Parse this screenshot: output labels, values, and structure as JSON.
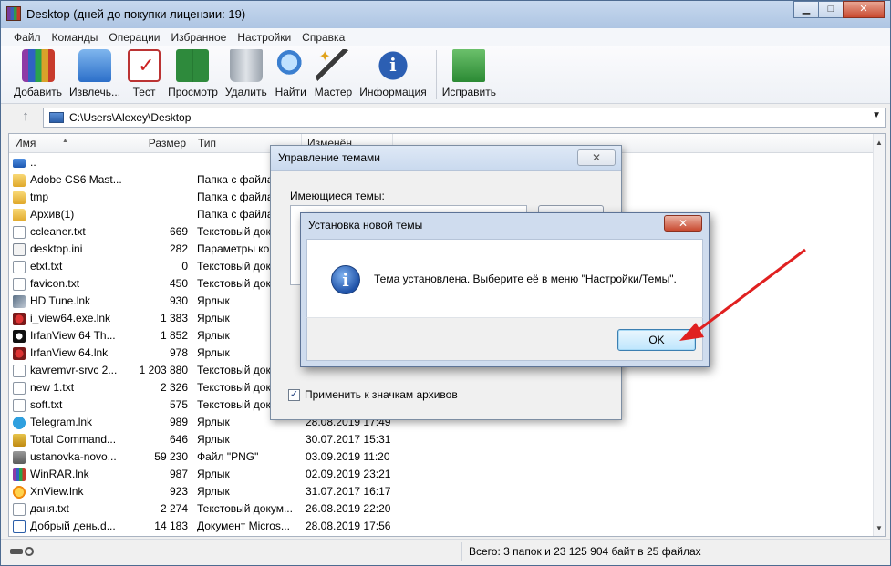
{
  "window": {
    "title": "Desktop (дней до покупки лицензии: 19)",
    "buttons": {
      "minimize": "▁",
      "maximize": "□",
      "close": "✕"
    }
  },
  "menu": [
    "Файл",
    "Команды",
    "Операции",
    "Избранное",
    "Настройки",
    "Справка"
  ],
  "toolbar": [
    {
      "label": "Добавить",
      "icon": "archive-add-icon"
    },
    {
      "label": "Извлечь...",
      "icon": "extract-folder-icon"
    },
    {
      "label": "Тест",
      "icon": "test-checklist-icon"
    },
    {
      "label": "Просмотр",
      "icon": "book-view-icon"
    },
    {
      "label": "Удалить",
      "icon": "trash-icon"
    },
    {
      "label": "Найти",
      "icon": "magnifier-icon"
    },
    {
      "label": "Мастер",
      "icon": "magic-wand-icon"
    },
    {
      "label": "Информация",
      "icon": "info-icon"
    },
    {
      "label": "Исправить",
      "icon": "repair-kit-icon"
    }
  ],
  "address": {
    "up_glyph": "↑",
    "path": "C:\\Users\\Alexey\\Desktop",
    "dropdown_glyph": "▼"
  },
  "columns": {
    "name": "Имя",
    "size": "Размер",
    "type": "Тип",
    "modified": "Изменён"
  },
  "files": [
    {
      "name": "..",
      "size": "",
      "type": "",
      "date": "",
      "icon": "up"
    },
    {
      "name": "Adobe CS6 Mast...",
      "size": "",
      "type": "Папка с файла",
      "date": "",
      "icon": "folder"
    },
    {
      "name": "tmp",
      "size": "",
      "type": "Папка с файла",
      "date": "",
      "icon": "folder"
    },
    {
      "name": "Архив(1)",
      "size": "",
      "type": "Папка с файла",
      "date": "",
      "icon": "folder"
    },
    {
      "name": "ccleaner.txt",
      "size": "669",
      "type": "Текстовый док",
      "date": "",
      "icon": "txt"
    },
    {
      "name": "desktop.ini",
      "size": "282",
      "type": "Параметры ко",
      "date": "",
      "icon": "ini"
    },
    {
      "name": "etxt.txt",
      "size": "0",
      "type": "Текстовый док",
      "date": "",
      "icon": "txt"
    },
    {
      "name": "favicon.txt",
      "size": "450",
      "type": "Текстовый док",
      "date": "",
      "icon": "txt"
    },
    {
      "name": "HD Tune.lnk",
      "size": "930",
      "type": "Ярлык",
      "date": "",
      "icon": "lnk"
    },
    {
      "name": "i_view64.exe.lnk",
      "size": "1 383",
      "type": "Ярлык",
      "date": "",
      "icon": "lnkred"
    },
    {
      "name": "IrfanView 64 Th...",
      "size": "1 852",
      "type": "Ярлык",
      "date": "",
      "icon": "panda"
    },
    {
      "name": "IrfanView 64.lnk",
      "size": "978",
      "type": "Ярлык",
      "date": "",
      "icon": "lnkred"
    },
    {
      "name": "kavremvr-srvc 2...",
      "size": "1 203 880",
      "type": "Текстовый док",
      "date": "",
      "icon": "txt"
    },
    {
      "name": "new 1.txt",
      "size": "2 326",
      "type": "Текстовый док",
      "date": "",
      "icon": "txt"
    },
    {
      "name": "soft.txt",
      "size": "575",
      "type": "Текстовый док",
      "date": "",
      "icon": "txt"
    },
    {
      "name": "Telegram.lnk",
      "size": "989",
      "type": "Ярлык",
      "date": "28.08.2019 17:49",
      "icon": "tg"
    },
    {
      "name": "Total Command...",
      "size": "646",
      "type": "Ярлык",
      "date": "30.07.2017 15:31",
      "icon": "tc"
    },
    {
      "name": "ustanovka-novo...",
      "size": "59 230",
      "type": "Файл \"PNG\"",
      "date": "03.09.2019 11:20",
      "icon": "png"
    },
    {
      "name": "WinRAR.lnk",
      "size": "987",
      "type": "Ярлык",
      "date": "02.09.2019 23:21",
      "icon": "rar"
    },
    {
      "name": "XnView.lnk",
      "size": "923",
      "type": "Ярлык",
      "date": "31.07.2017 16:17",
      "icon": "xn"
    },
    {
      "name": "даня.txt",
      "size": "2 274",
      "type": "Текстовый докум...",
      "date": "26.08.2019 22:20",
      "icon": "txt"
    },
    {
      "name": "Добрый день.d...",
      "size": "14 183",
      "type": "Документ Micros...",
      "date": "28.08.2019 17:56",
      "icon": "doc"
    }
  ],
  "status": {
    "summary": "Всего: 3 папок и 23 125 904 байт в 25 файлах"
  },
  "theme_dialog": {
    "title": "Управление темами",
    "close_glyph": "✕",
    "available_label": "Имеющиеся темы:",
    "checkbox_label": "Применить к значкам архивов",
    "checkbox_checked": true,
    "check_glyph": "✓"
  },
  "install_dialog": {
    "title": "Установка новой темы",
    "close_glyph": "✕",
    "info_glyph": "i",
    "message": "Тема установлена. Выберите её в меню \"Настройки/Темы\".",
    "ok_label": "OK"
  },
  "annotation": {
    "arrow_color": "#e02020"
  }
}
